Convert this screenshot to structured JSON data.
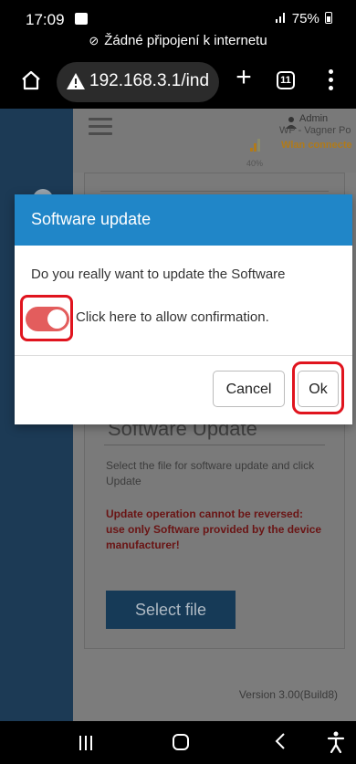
{
  "status_bar": {
    "time": "17:09",
    "battery": "75%",
    "offline_notice": "Žádné připojení k internetu"
  },
  "browser": {
    "url": "192.168.3.1/ind",
    "tab_count": "11"
  },
  "header": {
    "user": "Admin",
    "wifi_name": "WP - Vagner Po",
    "wlan_status": "Wlan connecte",
    "signal_percent": "40%"
  },
  "software_update": {
    "title": "Software Update",
    "description": "Select the file for software update and click Update",
    "warning": "Update operation cannot be reversed: use only Software provided by the device manufacturer!",
    "select_file_label": "Select file"
  },
  "footer": {
    "version": "Version 3.00(Build8)"
  },
  "modal": {
    "title": "Software update",
    "question": "Do you really want to update the Software",
    "toggle_label": "Click here to allow confirmation.",
    "toggle_on": true,
    "cancel_label": "Cancel",
    "ok_label": "Ok"
  },
  "colors": {
    "modal_header": "#2086c8",
    "toggle_on": "#e35d5d",
    "highlight": "#e0141e",
    "select_file_button": "#163a57",
    "wlan_status": "#b07a1a"
  }
}
